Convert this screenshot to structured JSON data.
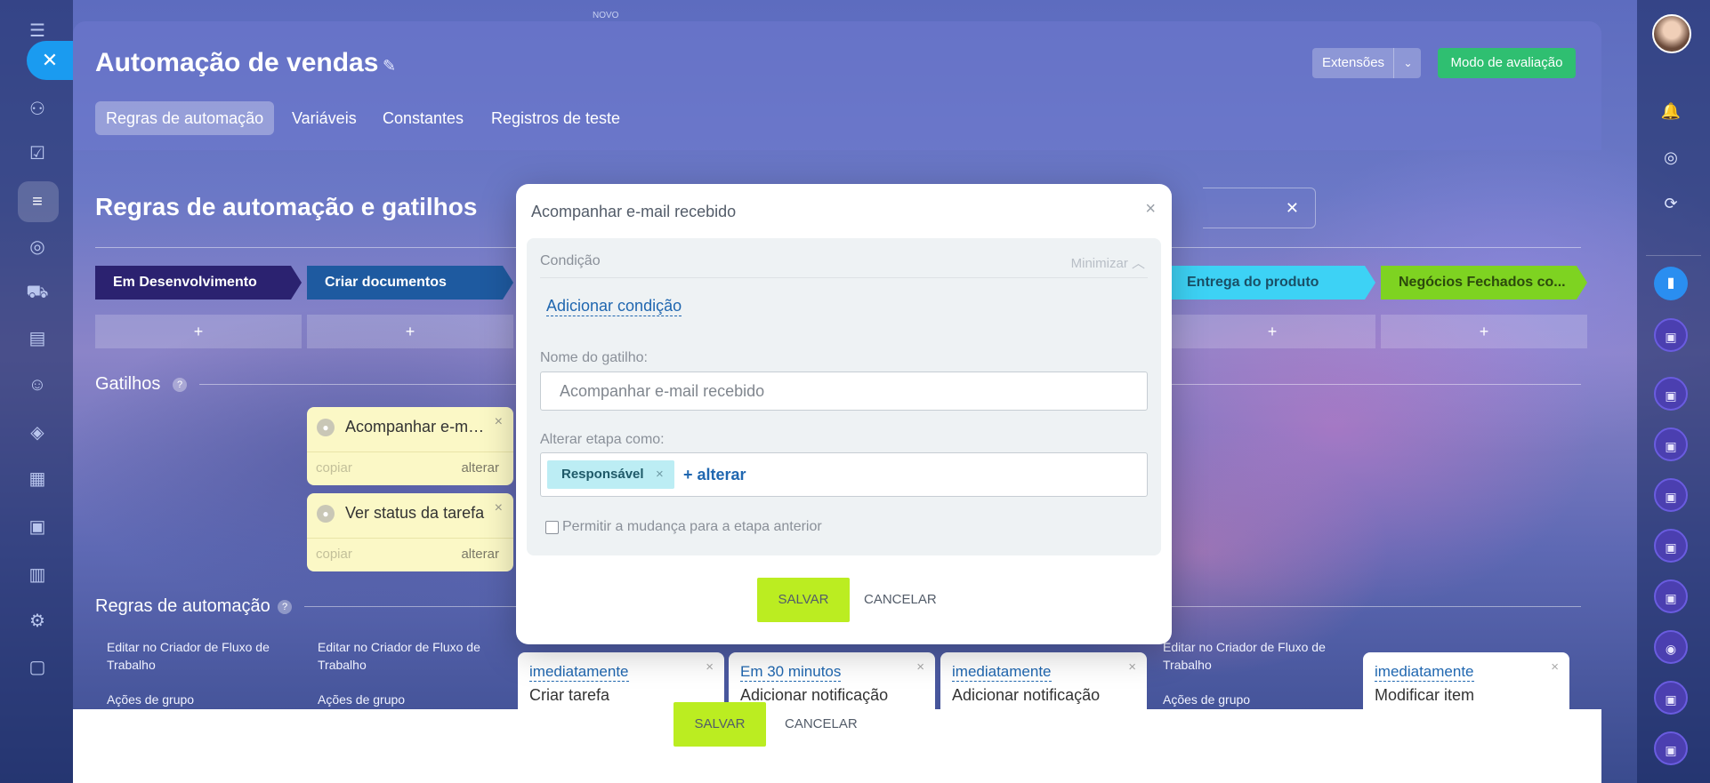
{
  "topbar": {
    "novo_label": "NOVO"
  },
  "header": {
    "title": "Automação de vendas",
    "extensions_label": "Extensões",
    "eval_mode_label": "Modo de avaliação",
    "tabs": [
      {
        "label": "Regras de automação"
      },
      {
        "label": "Variáveis"
      },
      {
        "label": "Constantes"
      },
      {
        "label": "Registros de teste"
      }
    ]
  },
  "section": {
    "title": "Regras de automação e gatilhos"
  },
  "stages": [
    {
      "label": "Em Desenvolvimento",
      "color": "#2b2270"
    },
    {
      "label": "Criar documentos",
      "color": "#1e5aa0"
    },
    {
      "label": "Entrega do produto",
      "color": "#3dd2f5"
    },
    {
      "label": "Negócios Fechados co...",
      "color": "#7ed321"
    }
  ],
  "triggers": {
    "title": "Gatilhos",
    "items": [
      {
        "title": "Acompanhar e-mai...",
        "copy": "copiar",
        "change": "alterar"
      },
      {
        "title": "Ver status da tarefa",
        "copy": "copiar",
        "change": "alterar"
      }
    ]
  },
  "rules": {
    "title": "Regras de automação",
    "edit_link": "Editar no Criador de Fluxo de Trabalho",
    "group_actions": "Ações de grupo",
    "cards": [
      {
        "when": "imediatamente",
        "action": "Criar tarefa"
      },
      {
        "when": "Em 30 minutos",
        "action": "Adicionar notificação"
      },
      {
        "when": "imediatamente",
        "action": "Adicionar notificação"
      },
      {
        "when": "imediatamente",
        "action": "Modificar item"
      }
    ]
  },
  "footer": {
    "save": "SALVAR",
    "cancel": "CANCELAR"
  },
  "dialog": {
    "title": "Acompanhar e-mail recebido",
    "condition_label": "Condição",
    "minimize_label": "Minimizar",
    "add_condition": "Adicionar condição",
    "trigger_name_label": "Nome do gatilho:",
    "trigger_name_value": "Acompanhar e-mail recebido",
    "change_stage_label": "Alterar etapa como:",
    "tag": "Responsável",
    "change_link": "+ alterar",
    "checkbox_label": "Permitir a mudança para a etapa anterior",
    "save": "SALVAR",
    "cancel": "CANCELAR"
  }
}
